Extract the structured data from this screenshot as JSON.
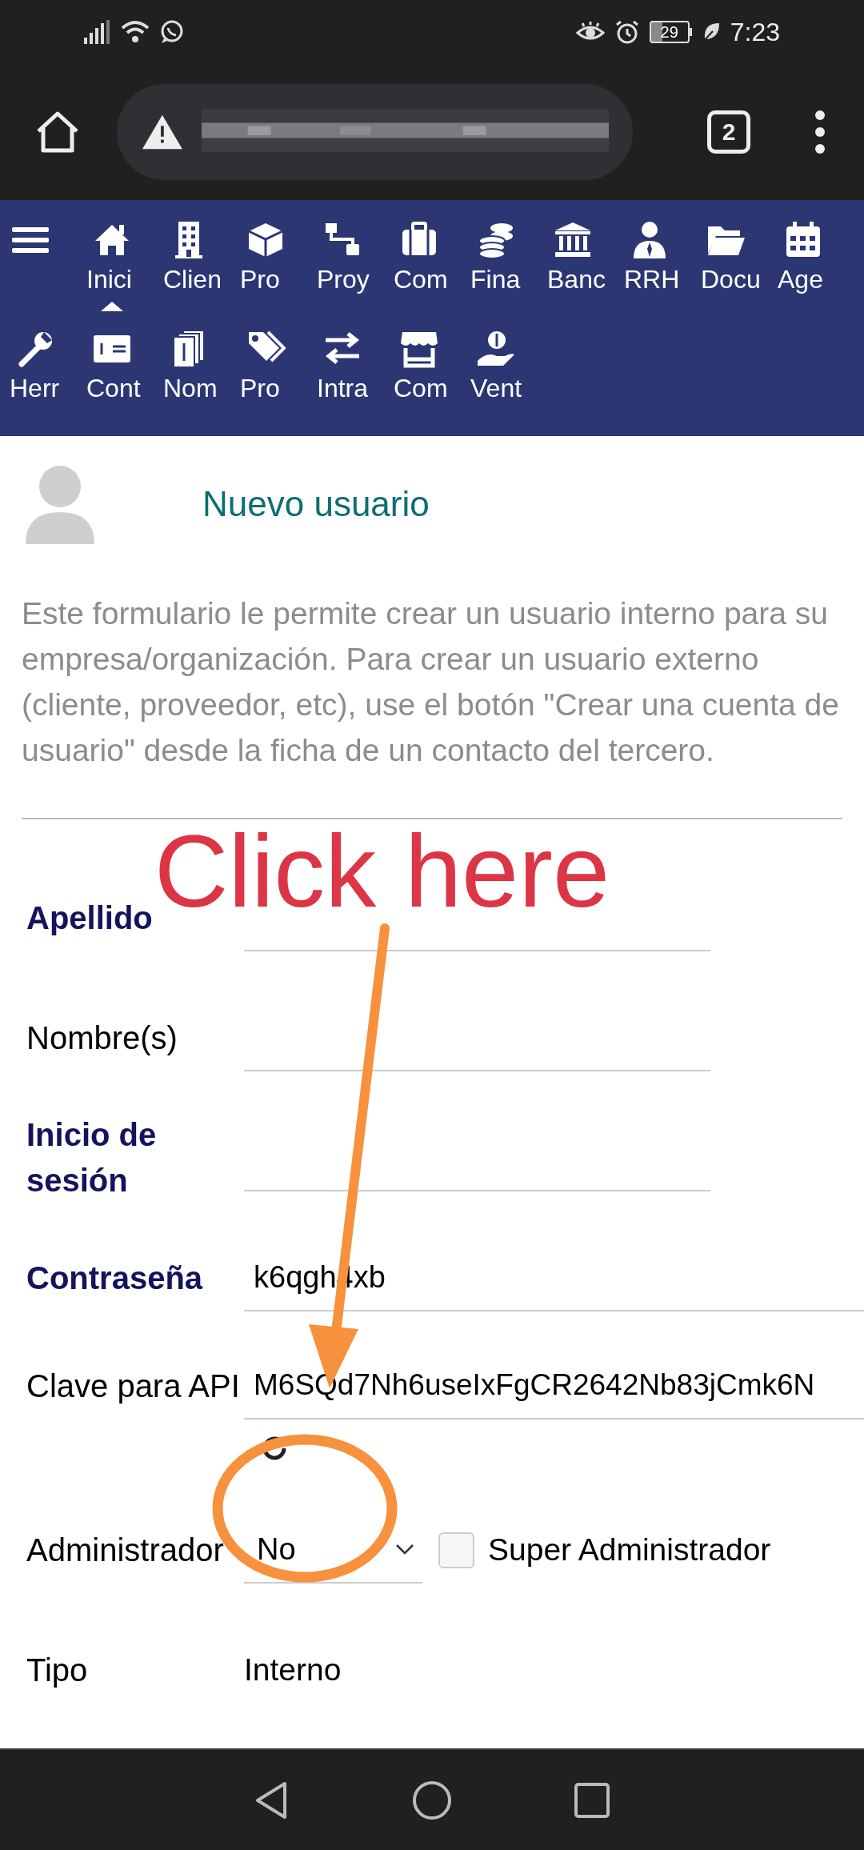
{
  "status_bar": {
    "battery": "29",
    "time": "7:23"
  },
  "browser": {
    "tab_count": "2"
  },
  "nav": {
    "items": [
      {
        "label": "Inici",
        "selected": true
      },
      {
        "label": "Clien",
        "selected": false
      },
      {
        "label": "Pro",
        "selected": false
      },
      {
        "label": "Proy",
        "selected": false
      },
      {
        "label": "Com",
        "selected": false
      },
      {
        "label": "Fina",
        "selected": false
      },
      {
        "label": "Banc",
        "selected": false
      },
      {
        "label": "RRH",
        "selected": false
      },
      {
        "label": "Docu",
        "selected": false
      },
      {
        "label": "Age",
        "selected": false
      },
      {
        "label": "Herr",
        "selected": false
      },
      {
        "label": "Cont",
        "selected": false
      },
      {
        "label": "Nom",
        "selected": false
      },
      {
        "label": "Pro",
        "selected": false
      },
      {
        "label": "Intra",
        "selected": false
      },
      {
        "label": "Com",
        "selected": false
      },
      {
        "label": "Vent",
        "selected": false
      }
    ]
  },
  "page": {
    "title": "Nuevo usuario",
    "intro": "Este formulario le permite crear un usuario interno para su empresa/organización. Para crear un usuario externo (cliente, proveedor, etc), use el botón \"Crear una cuenta de usuario\" desde la ficha de un contacto del tercero.",
    "fields": [
      {
        "kind": "input",
        "label": "Apellido",
        "required": true
      },
      {
        "kind": "input",
        "label": "Nombre(s)",
        "required": false
      },
      {
        "kind": "input",
        "label": "Inicio de sesión",
        "required": true
      },
      {
        "kind": "input",
        "label": "Contraseña",
        "required": true,
        "value": "k6qgh4xb"
      },
      {
        "kind": "api_key",
        "label": "Clave para API",
        "required": false,
        "value": "M6SQd7Nh6useIxFgCR2642Nb83jCmk6N"
      },
      {
        "kind": "select",
        "label": "Administrador",
        "required": false,
        "value": "No",
        "checkbox": {
          "label": "Super Administrador",
          "checked": false
        }
      },
      {
        "kind": "static",
        "label": "Tipo",
        "required": false,
        "value": "Interno"
      }
    ]
  },
  "annotation": {
    "text": "Click here"
  }
}
